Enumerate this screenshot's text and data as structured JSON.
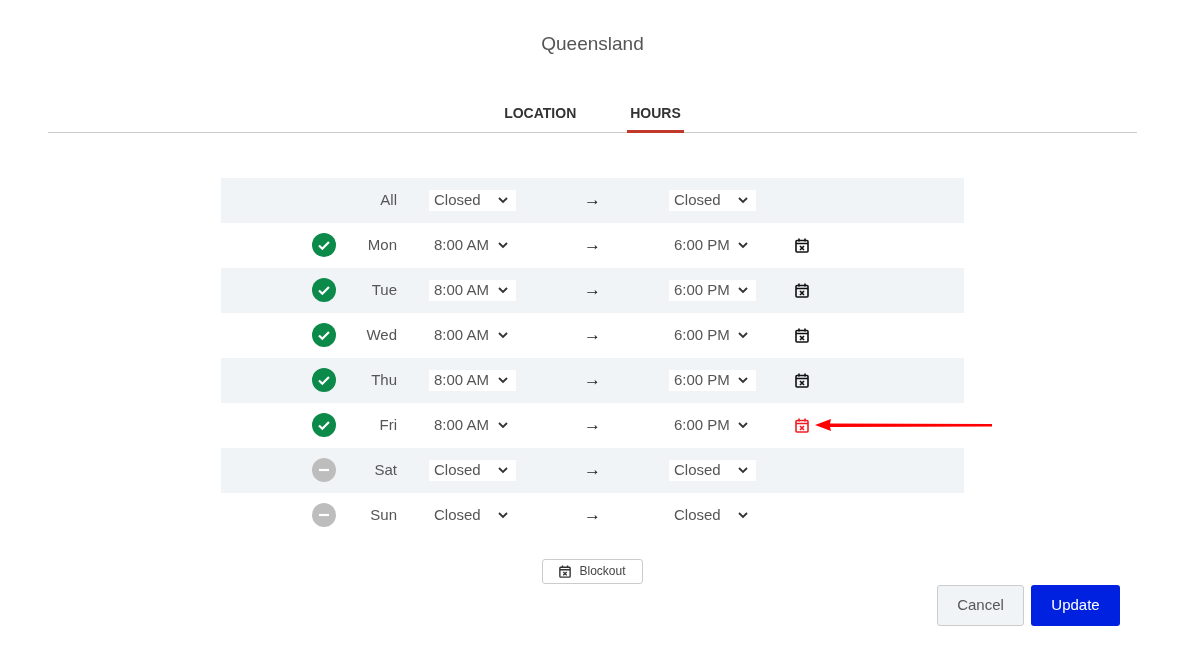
{
  "title": "Queensland",
  "tabs": [
    {
      "label": "LOCATION",
      "selected": false
    },
    {
      "label": "HOURS",
      "selected": true
    }
  ],
  "rows": [
    {
      "day": "All",
      "from": "Closed",
      "to": "Closed",
      "arrow": "→",
      "blockout": false
    },
    {
      "day": "Mon",
      "open": true,
      "from": "8:00 AM",
      "to": "6:00 PM",
      "arrow": "→",
      "blockout": true,
      "highlighted": false
    },
    {
      "day": "Tue",
      "open": true,
      "from": "8:00 AM",
      "to": "6:00 PM",
      "arrow": "→",
      "blockout": true,
      "highlighted": false
    },
    {
      "day": "Wed",
      "open": true,
      "from": "8:00 AM",
      "to": "6:00 PM",
      "arrow": "→",
      "blockout": true,
      "highlighted": false
    },
    {
      "day": "Thu",
      "open": true,
      "from": "8:00 AM",
      "to": "6:00 PM",
      "arrow": "→",
      "blockout": true,
      "highlighted": false
    },
    {
      "day": "Fri",
      "open": true,
      "from": "8:00 AM",
      "to": "6:00 PM",
      "arrow": "→",
      "blockout": true,
      "highlighted": true
    },
    {
      "day": "Sat",
      "open": false,
      "from": "Closed",
      "to": "Closed",
      "arrow": "→",
      "blockout": false
    },
    {
      "day": "Sun",
      "open": false,
      "from": "Closed",
      "to": "Closed",
      "arrow": "→",
      "blockout": false
    }
  ],
  "blockout_button": "Blockout",
  "buttons": [
    {
      "label": "Cancel",
      "kind": "secondary"
    },
    {
      "label": "Update",
      "kind": "primary"
    }
  ]
}
